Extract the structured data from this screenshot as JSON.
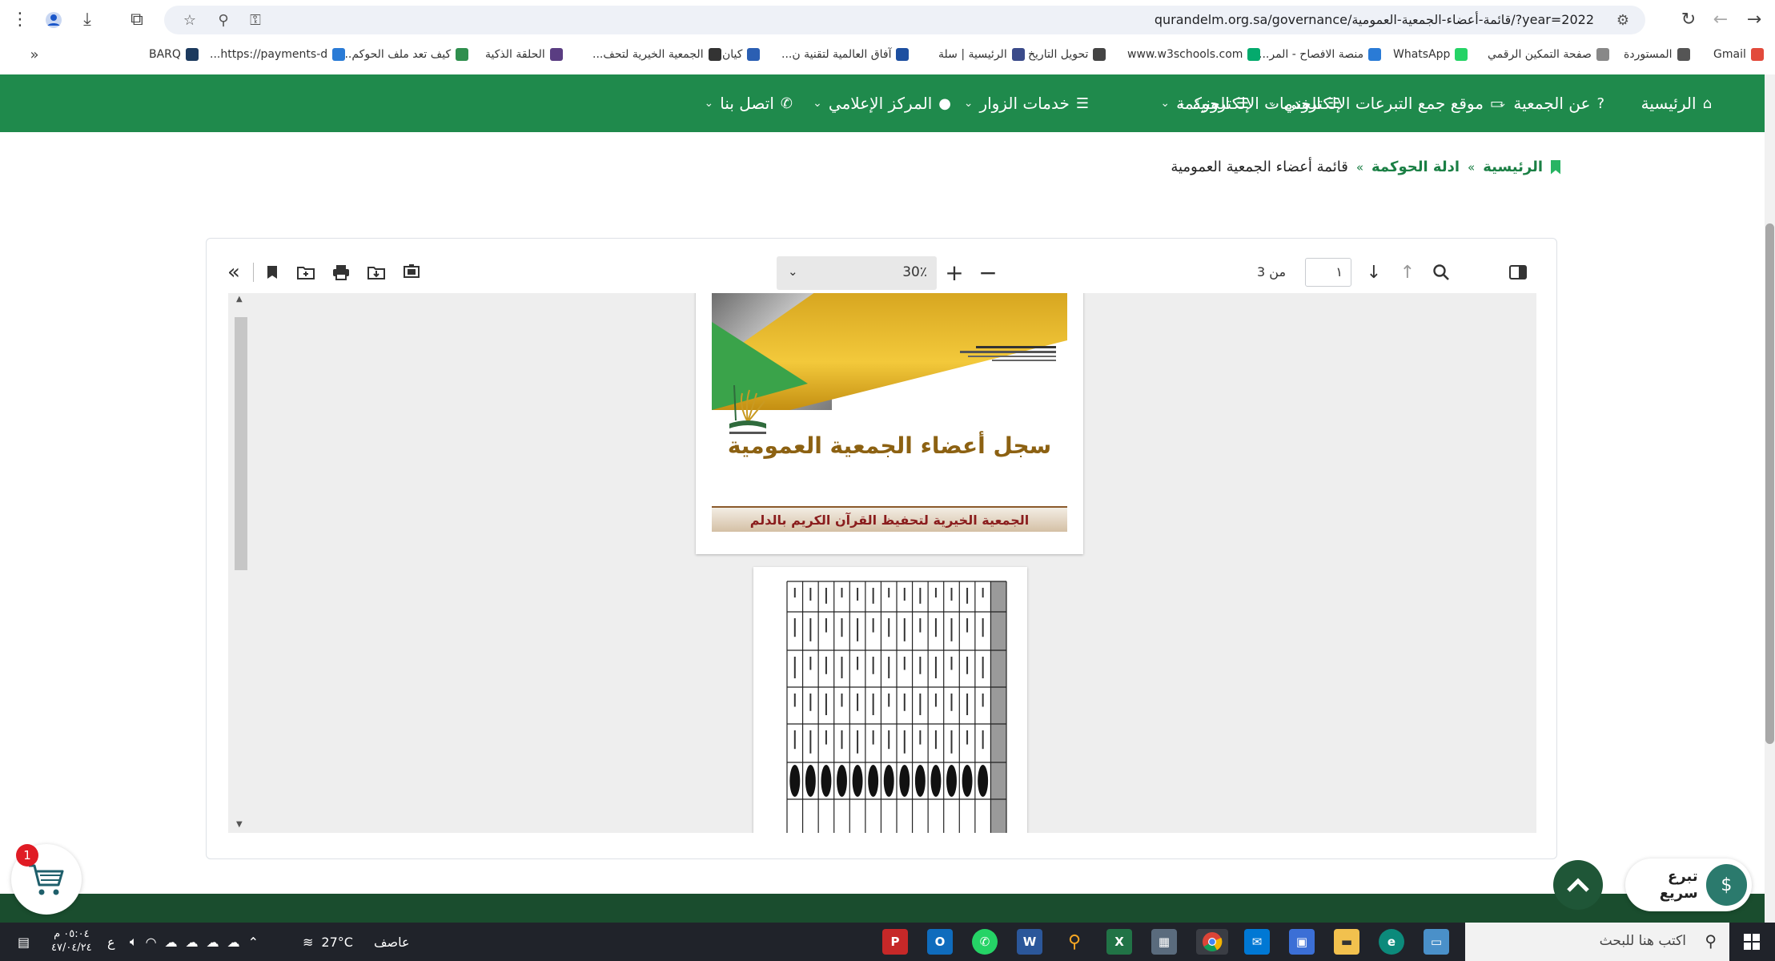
{
  "browser": {
    "url": "qurandelm.org.sa/governance/قائمة-أعضاء-الجمعية-العمومية/?year=2022",
    "bookmarks": [
      {
        "label": "Gmail",
        "color": "#e24a3b"
      },
      {
        "label": "المستوردة",
        "color": "#555555"
      },
      {
        "label": "صفحة التمكين الرقمي",
        "color": "#888888"
      },
      {
        "label": "WhatsApp",
        "color": "#25d366"
      },
      {
        "label": "منصة الافصاح - المر...",
        "color": "#2a7bd6"
      },
      {
        "label": "www.w3schools.com",
        "color": "#04aa6d"
      },
      {
        "label": "تحويل التاريخ",
        "color": "#444444"
      },
      {
        "label": "الرئيسية | سلة",
        "color": "#3a4a8a"
      },
      {
        "label": "آفاق العالمية لتقنية ن...",
        "color": "#1d4fa0"
      },
      {
        "label": "كيان",
        "color": "#2b5fb3"
      },
      {
        "label": "الجمعية الخيرية لتحف...",
        "color": "#333333"
      },
      {
        "label": "الحلقة الذكية",
        "color": "#5a3d82"
      },
      {
        "label": "كيف تعد ملف الحوكم...",
        "color": "#2f8f4e"
      },
      {
        "label": "https://payments-d...",
        "color": "#2a7bd6"
      },
      {
        "label": "BARQ",
        "color": "#1c3a5e"
      }
    ]
  },
  "nav": {
    "items": [
      {
        "label": "الرئيسية",
        "icon": "home-icon",
        "glyph": "⌂",
        "chevron": false
      },
      {
        "label": "عن الجمعية",
        "icon": "question-icon",
        "glyph": "?",
        "chevron": true
      },
      {
        "label": "موقع جمع التبرعات الإلكتروني",
        "icon": "card-icon",
        "glyph": "▭",
        "chevron": true
      },
      {
        "label": "الخدمات الإلكترونية",
        "icon": "users-icon",
        "glyph": "☷",
        "chevron": true
      },
      {
        "label": "الحوكمة",
        "icon": "list-icon",
        "glyph": "☰",
        "chevron": true
      },
      {
        "label": "خدمات الزوار",
        "icon": "server-icon",
        "glyph": "☰",
        "chevron": true
      },
      {
        "label": "المركز الإعلامي",
        "icon": "microphone-icon",
        "glyph": "●",
        "chevron": true
      },
      {
        "label": "اتصل بنا",
        "icon": "phone-icon",
        "glyph": "✆",
        "chevron": true
      }
    ]
  },
  "breadcrumb": {
    "home": "الرئيسية",
    "section": "ادلة الحوكمة",
    "current": "قائمة أعضاء الجمعية العمومية",
    "separator": "»"
  },
  "viewer": {
    "zoom": "30٪",
    "page_current": "١",
    "page_total_label": "من 3",
    "doc_title": "سجل أعضاء الجمعية العمومية",
    "doc_org": "الجمعية الخيرية لتحفيظ القرآن الكريم بالدلم"
  },
  "widgets": {
    "cart_count": "1",
    "quick_donate": "تبرع سريع"
  },
  "taskbar": {
    "weather_temp": "27°C",
    "weather_text": "عاصف",
    "time": "٠٥:٠٤ م",
    "date": "٤٧/٠٤/٢٤",
    "lang": "ع",
    "search_placeholder": "اكتب هنا للبحث"
  },
  "colors": {
    "nav_green": "#1f8a4c",
    "footer_green": "#1a4d2e",
    "link_green": "#1a7f44"
  }
}
